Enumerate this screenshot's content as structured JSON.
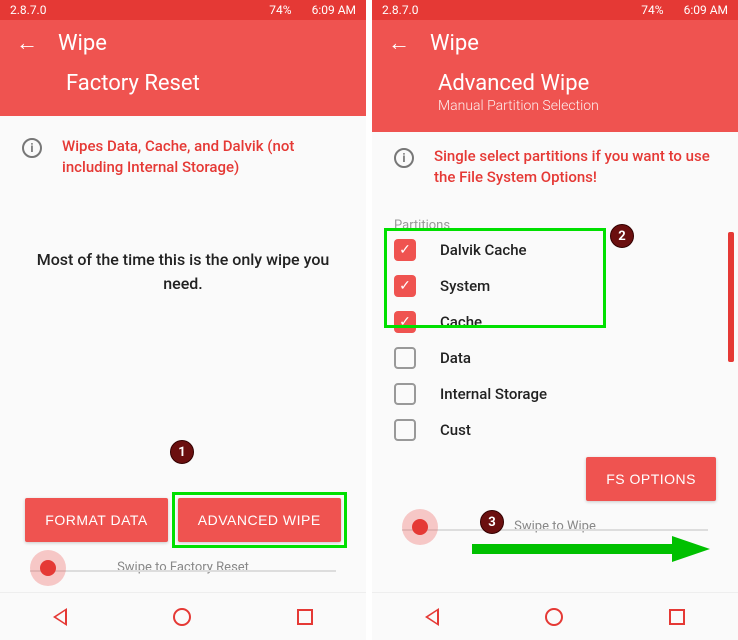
{
  "status": {
    "version": "2.8.7.0",
    "battery": "74%",
    "time": "6:09 AM"
  },
  "left": {
    "header_title": "Wipe",
    "page_title": "Factory Reset",
    "info_text": "Wipes Data, Cache, and Dalvik (not including Internal Storage)",
    "body_text": "Most of the time this is the only wipe you need.",
    "buttons": {
      "format_data": "FORMAT DATA",
      "advanced_wipe": "ADVANCED WIPE"
    },
    "swipe_label": "Swipe to Factory Reset"
  },
  "right": {
    "header_title": "Wipe",
    "page_title": "Advanced Wipe",
    "subtitle": "Manual Partition Selection",
    "info_text": "Single select partitions if you want to use the File System Options!",
    "partitions_label": "Partitions",
    "partitions": [
      {
        "label": "Dalvik Cache",
        "checked": true
      },
      {
        "label": "System",
        "checked": true
      },
      {
        "label": "Cache",
        "checked": true
      },
      {
        "label": "Data",
        "checked": false
      },
      {
        "label": "Internal Storage",
        "checked": false
      },
      {
        "label": "Cust",
        "checked": false
      }
    ],
    "buttons": {
      "fs_options": "FS OPTIONS"
    },
    "swipe_label": "Swipe to Wipe"
  },
  "annotations": [
    {
      "n": "1",
      "screen": "left"
    },
    {
      "n": "2",
      "screen": "right"
    },
    {
      "n": "3",
      "screen": "right"
    }
  ],
  "colors": {
    "accent": "#ef5350",
    "accent_dark": "#e53935",
    "annotation_green": "#00e000",
    "badge_bg": "#6b0f0f"
  }
}
